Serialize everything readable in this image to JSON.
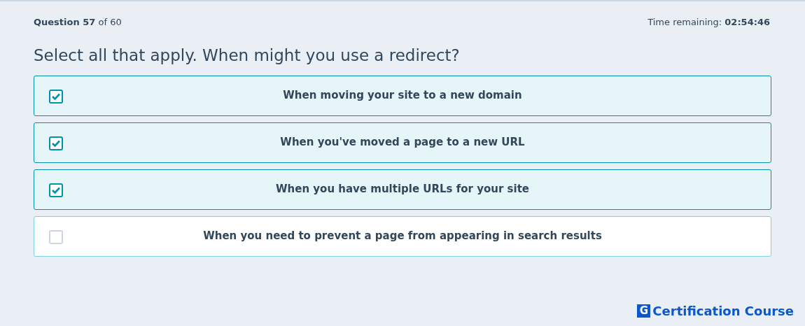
{
  "header": {
    "question_label": "Question",
    "question_number": "57",
    "question_total": "of 60",
    "time_label": "Time remaining:",
    "time_value": "02:54:46"
  },
  "question": "Select all that apply. When might you use a redirect?",
  "options": [
    {
      "label": "When moving your site to a new domain",
      "checked": true
    },
    {
      "label": "When you've moved a page to a new URL",
      "checked": true
    },
    {
      "label": "When you have multiple URLs for your site",
      "checked": true
    },
    {
      "label": "When you need to prevent a page from appearing in search results",
      "checked": false
    }
  ],
  "brand": {
    "letter": "G",
    "name": "Certification Course"
  }
}
